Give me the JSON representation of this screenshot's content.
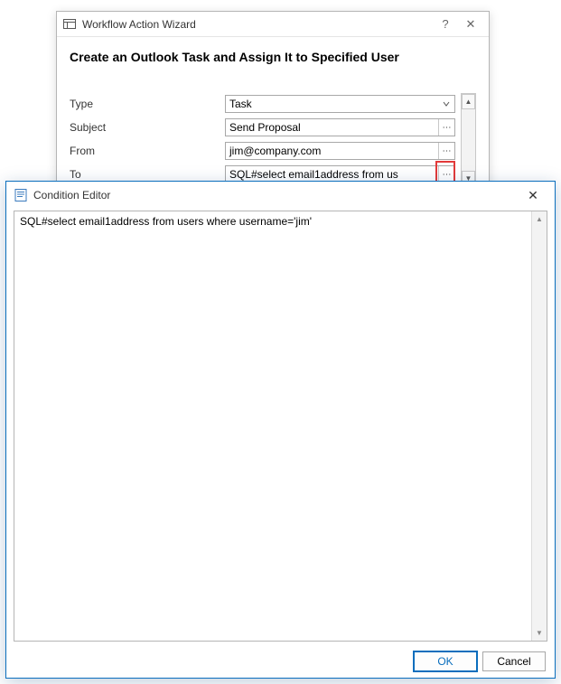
{
  "wizard": {
    "title": "Workflow Action Wizard",
    "heading": "Create an Outlook Task and Assign It to Specified User",
    "fields": {
      "type": {
        "label": "Type",
        "value": "Task"
      },
      "subject": {
        "label": "Subject",
        "value": "Send Proposal"
      },
      "from": {
        "label": "From",
        "value": "jim@company.com"
      },
      "to": {
        "label": "To",
        "value": "SQL#select email1address from us"
      }
    },
    "help_glyph": "?",
    "close_glyph": "✕",
    "ellipsis": "⋯"
  },
  "condition_editor": {
    "title": "Condition Editor",
    "text": "SQL#select email1address from users where username='jim'",
    "buttons": {
      "ok": "OK",
      "cancel": "Cancel"
    },
    "close_glyph": "✕"
  }
}
